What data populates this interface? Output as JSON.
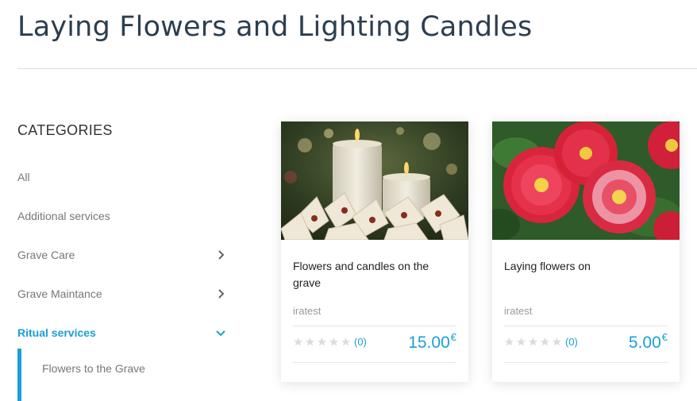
{
  "page": {
    "title": "Laying Flowers and Lighting Candles"
  },
  "sidebar": {
    "heading": "CATEGORIES",
    "items": [
      {
        "label": "All",
        "icon": null,
        "active": false
      },
      {
        "label": "Additional services",
        "icon": null,
        "active": false
      },
      {
        "label": "Grave Care",
        "icon": "chevron-right-icon",
        "active": false
      },
      {
        "label": "Grave Maintance",
        "icon": "chevron-right-icon",
        "active": false
      },
      {
        "label": "Ritual services",
        "icon": "chevron-down-icon",
        "active": true
      }
    ],
    "subitems": [
      {
        "label": "Flowers to the Grave"
      }
    ]
  },
  "products": [
    {
      "title": "Flowers and candles on the grave",
      "vendor": "iratest",
      "rating_count": "(0)",
      "rating_stars": 0,
      "price": "15.00",
      "currency": "€",
      "image": "candles-and-white-poinsettias-photo"
    },
    {
      "title": "Laying flowers on",
      "vendor": "iratest",
      "rating_count": "(0)",
      "rating_stars": 0,
      "price": "5.00",
      "currency": "€",
      "image": "red-daisies-photo"
    }
  ],
  "colors": {
    "accent": "#1a9fd8",
    "title": "#2d3e50",
    "muted_text": "#777777",
    "star_empty": "#dddddd"
  }
}
